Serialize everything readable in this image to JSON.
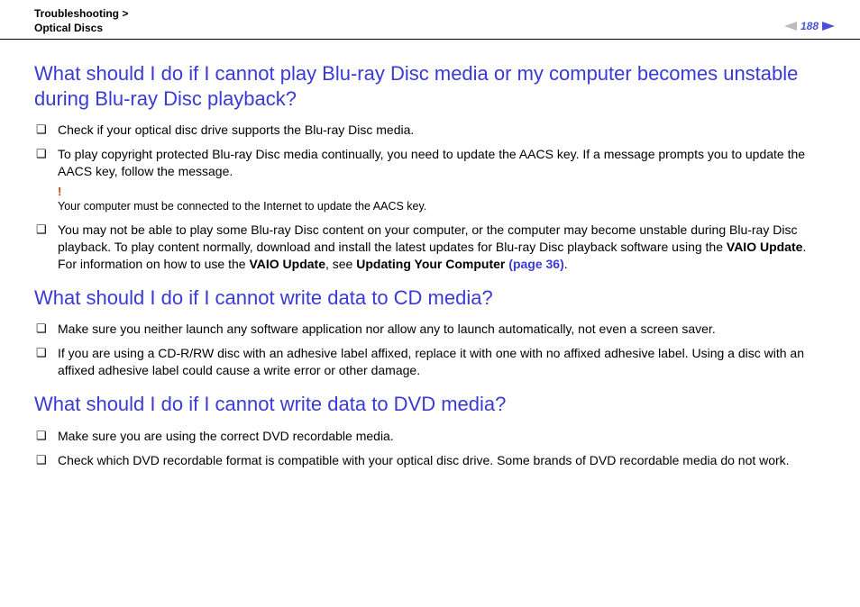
{
  "header": {
    "breadcrumb_section": "Troubleshooting >",
    "breadcrumb_sub": "Optical Discs",
    "page_number": "188"
  },
  "sections": [
    {
      "heading": "What should I do if I cannot play Blu-ray Disc media or my computer becomes unstable during Blu-ray Disc playback?",
      "items": [
        {
          "text": "Check if your optical disc drive supports the Blu-ray Disc media."
        },
        {
          "text": "To play copyright protected Blu-ray Disc media continually, you need to update the AACS key. If a message prompts you to update the AACS key, follow the message.",
          "note_bang": "!",
          "note_text": "Your computer must be connected to the Internet to update the AACS key."
        },
        {
          "pre": "You may not be able to play some Blu-ray Disc content on your computer, or the computer may become unstable during Blu-ray Disc playback. To play content normally, download and install the latest updates for Blu-ray Disc playback software using the ",
          "bold1": "VAIO Update",
          "mid1": ".",
          "br": true,
          "pre2": "For information on how to use the ",
          "bold2": "VAIO Update",
          "mid2": ", see ",
          "bold3": "Updating Your Computer ",
          "link": "(page 36)",
          "post": "."
        }
      ]
    },
    {
      "heading": "What should I do if I cannot write data to CD media?",
      "items": [
        {
          "text": "Make sure you neither launch any software application nor allow any to launch automatically, not even a screen saver."
        },
        {
          "text": "If you are using a CD-R/RW disc with an adhesive label affixed, replace it with one with no affixed adhesive label. Using a disc with an affixed adhesive label could cause a write error or other damage."
        }
      ]
    },
    {
      "heading": "What should I do if I cannot write data to DVD media?",
      "items": [
        {
          "text": "Make sure you are using the correct DVD recordable media."
        },
        {
          "text": "Check which DVD recordable format is compatible with your optical disc drive. Some brands of DVD recordable media do not work."
        }
      ]
    }
  ]
}
